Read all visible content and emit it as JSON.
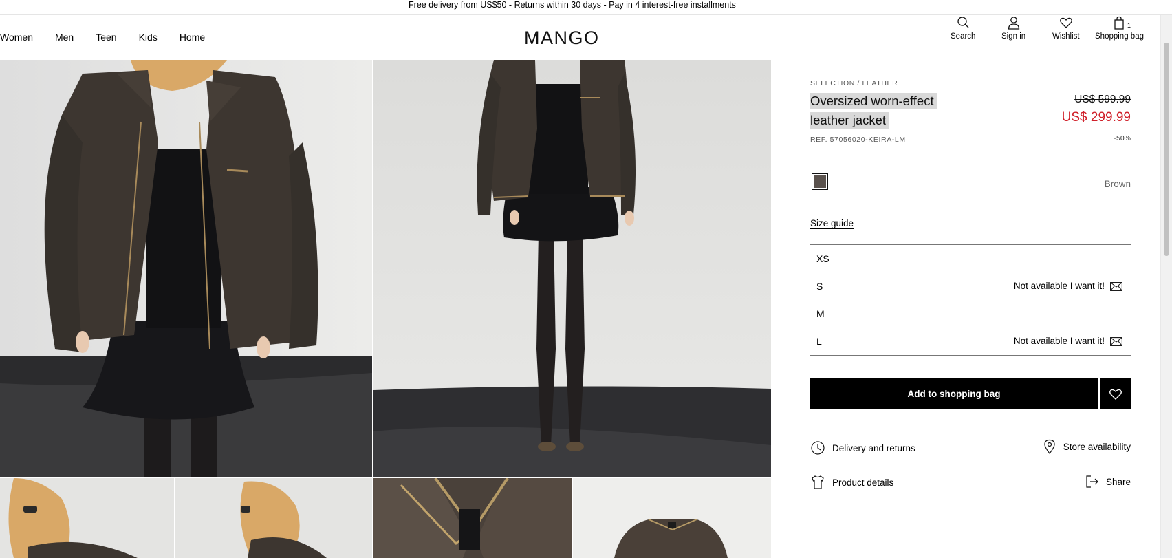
{
  "announcement": "Free delivery from US$50 - Returns within 30 days - Pay in 4 interest-free installments",
  "nav": [
    {
      "label": "Women",
      "active": true
    },
    {
      "label": "Men"
    },
    {
      "label": "Teen"
    },
    {
      "label": "Kids"
    },
    {
      "label": "Home"
    }
  ],
  "brand": "MANGO",
  "actions": {
    "search": {
      "label": "Search",
      "icon": "search-icon"
    },
    "signin": {
      "label": "Sign in",
      "icon": "user-icon"
    },
    "wishlist": {
      "label": "Wishlist",
      "icon": "heart-icon"
    },
    "bag": {
      "label": "Shopping bag",
      "icon": "bag-icon",
      "count": "1"
    }
  },
  "product": {
    "breadcrumb": "SELECTION / LEATHER",
    "title_line1": "Oversized worn-effect",
    "title_line2": "leather jacket",
    "old_price": "US$ 599.99",
    "new_price": "US$ 299.99",
    "ref": "REF. 57056020-KEIRA-LM",
    "discount": "-50%",
    "color": {
      "name": "Brown",
      "hex": "#5a524d"
    },
    "size_guide": "Size guide",
    "sizes": [
      {
        "label": "XS",
        "status": ""
      },
      {
        "label": "S",
        "status": "Not available I want it!"
      },
      {
        "label": "M",
        "status": ""
      },
      {
        "label": "L",
        "status": "Not available I want it!"
      }
    ],
    "add_to_bag": "Add to shopping bag",
    "links": {
      "delivery": "Delivery and returns",
      "store": "Store availability",
      "details": "Product details",
      "share": "Share"
    }
  },
  "colors": {
    "sale_red": "#d0202a",
    "jacket_brown": "#3e3731",
    "studio_grey": "#e4e4e2"
  }
}
